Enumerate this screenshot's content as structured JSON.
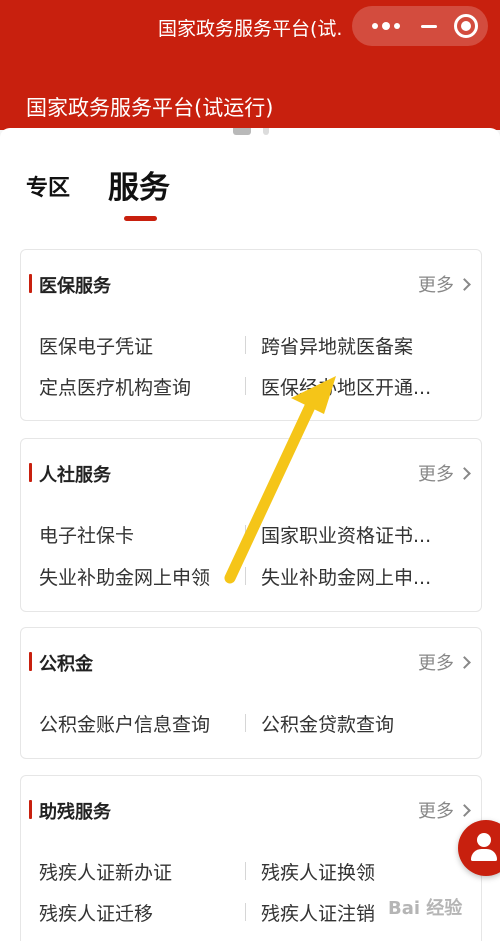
{
  "window": {
    "title": "国家政务服务平台(试..."
  },
  "capsule": {
    "more_icon": "more-dots-icon",
    "minimize_icon": "minimize-icon",
    "close_icon": "circle-close-icon"
  },
  "header": {
    "title": "国家政务服务平台(试运行)"
  },
  "tabs": {
    "zone_label": "专区",
    "service_label": "服务"
  },
  "colors": {
    "accent": "#c8200e",
    "arrow": "#f5c518"
  },
  "sections": [
    {
      "title": "医保服务",
      "more": "更多",
      "items": [
        "医保电子凭证",
        "跨省异地就医备案",
        "定点医疗机构查询",
        "医保经办地区开通..."
      ]
    },
    {
      "title": "人社服务",
      "more": "更多",
      "items": [
        "电子社保卡",
        "国家职业资格证书...",
        "失业补助金网上申领",
        "失业补助金网上申..."
      ]
    },
    {
      "title": "公积金",
      "more": "更多",
      "items": [
        "公积金账户信息查询",
        "公积金贷款查询"
      ]
    },
    {
      "title": "助残服务",
      "more": "更多",
      "items": [
        "残疾人证新办证",
        "残疾人证换领",
        "残疾人证迁移",
        "残疾人证注销"
      ]
    }
  ],
  "floating": {
    "icon": "user-service-icon"
  },
  "watermark": {
    "text": "Bai 经验"
  }
}
